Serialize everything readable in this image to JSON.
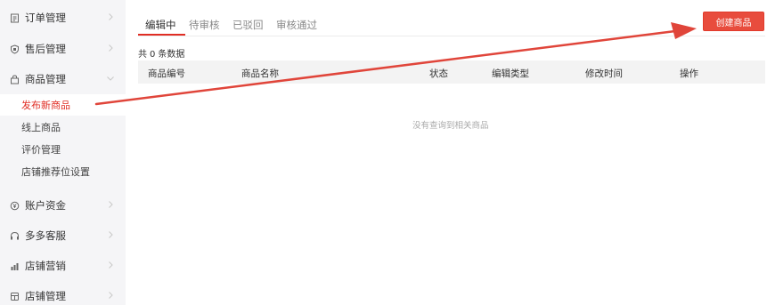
{
  "sidebar": {
    "groups": [
      {
        "label": "订单管理",
        "icon": "document-icon"
      },
      {
        "label": "售后管理",
        "icon": "shield-icon"
      },
      {
        "label": "商品管理",
        "icon": "bag-icon"
      },
      {
        "label": "账户资金",
        "icon": "coin-icon"
      },
      {
        "label": "多多客服",
        "icon": "headset-icon"
      },
      {
        "label": "店铺营销",
        "icon": "chart-bars-icon"
      },
      {
        "label": "店铺管理",
        "icon": "store-icon"
      }
    ],
    "sub_items": [
      {
        "label": "发布新商品",
        "active": true
      },
      {
        "label": "线上商品",
        "active": false
      },
      {
        "label": "评价管理",
        "active": false
      },
      {
        "label": "店铺推荐位设置",
        "active": false
      }
    ]
  },
  "tabs": [
    {
      "label": "编辑中",
      "active": true
    },
    {
      "label": "待审核",
      "active": false
    },
    {
      "label": "已驳回",
      "active": false
    },
    {
      "label": "审核通过",
      "active": false
    }
  ],
  "create_button_label": "创建商品",
  "record_count": {
    "prefix": "共",
    "value": "0",
    "suffix": "条数据"
  },
  "table": {
    "columns": [
      "商品编号",
      "商品名称",
      "状态",
      "编辑类型",
      "修改时间",
      "操作"
    ],
    "rows": [],
    "empty_text": "没有查询到相关商品"
  },
  "colors": {
    "accent": "#e02e24",
    "button": "#e84c3d",
    "sidebar_bg": "#f5f5f7",
    "annotation_arrow": "#e0453a"
  }
}
